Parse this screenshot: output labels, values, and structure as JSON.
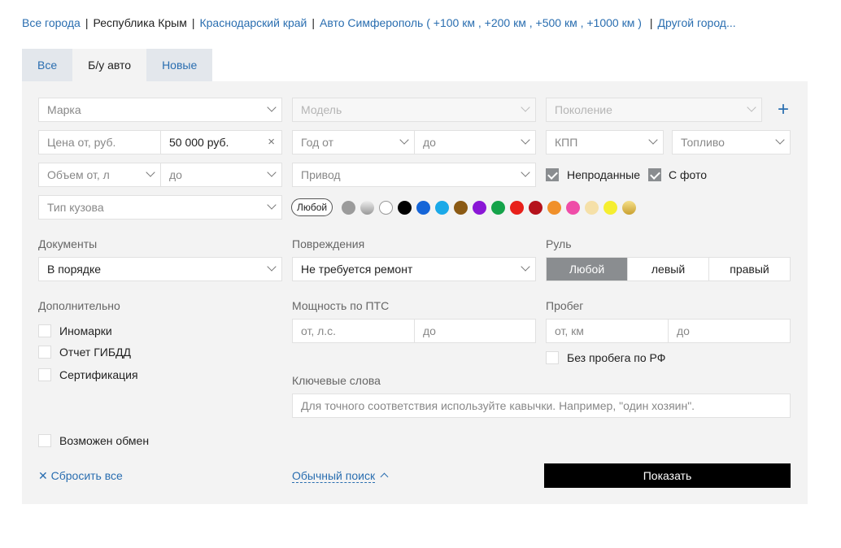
{
  "breadcrumbs": {
    "all_cities": "Все города",
    "region": "Республика Крым",
    "krasnodar": "Краснодарский край",
    "city": "Авто Симферополь",
    "paren_open": "(",
    "r100": "+100 км",
    "r200": "+200 км",
    "r500": "+500 км",
    "r1000": "+1000 км",
    "paren_close": ")",
    "other": "Другой город..."
  },
  "tabs": [
    "Все",
    "Б/у авто",
    "Новые"
  ],
  "filters": {
    "brand": "Марка",
    "model": "Модель",
    "generation": "Поколение",
    "price_from": "Цена от, руб.",
    "price_to": "50 000 руб.",
    "year_from": "Год от",
    "year_to": "до",
    "gearbox": "КПП",
    "fuel": "Топливо",
    "volume_from": "Объем от, л",
    "volume_to": "до",
    "drive": "Привод",
    "unsold": "Непроданные",
    "with_photo": "С фото",
    "body": "Тип кузова",
    "color_any": "Любой",
    "colors": [
      "#9b9b9b",
      "#c8c8c8",
      "#ffffff",
      "#000000",
      "#1565d8",
      "#1aa9e8",
      "#8b5a14",
      "#8a17d6",
      "#15a34a",
      "#e8201a",
      "#b5121b",
      "#f0902a",
      "#ef4da8",
      "#f5e0a8",
      "#f5ee30",
      "#e0c040"
    ]
  },
  "documents": {
    "label": "Документы",
    "value": "В порядке"
  },
  "damage": {
    "label": "Повреждения",
    "value": "Не требуется ремонт"
  },
  "wheel": {
    "label": "Руль",
    "options": [
      "Любой",
      "левый",
      "правый"
    ]
  },
  "extra": {
    "label": "Дополнительно",
    "options": [
      "Иномарки",
      "Отчет ГИБДД",
      "Сертификация"
    ],
    "exchange": "Возможен обмен"
  },
  "power": {
    "label": "Мощность по ПТС",
    "from": "от, л.с.",
    "to": "до"
  },
  "mileage": {
    "label": "Пробег",
    "from": "от, км",
    "to": "до",
    "no_rf": "Без пробега по РФ"
  },
  "keywords": {
    "label": "Ключевые слова",
    "placeholder": "Для точного соответствия используйте кавычки. Например, \"один хозяин\"."
  },
  "actions": {
    "reset": "Сбросить все",
    "simple": "Обычный поиск",
    "show": "Показать"
  },
  "icons": {
    "plus": "+",
    "clear": "×",
    "reset": "✕"
  }
}
